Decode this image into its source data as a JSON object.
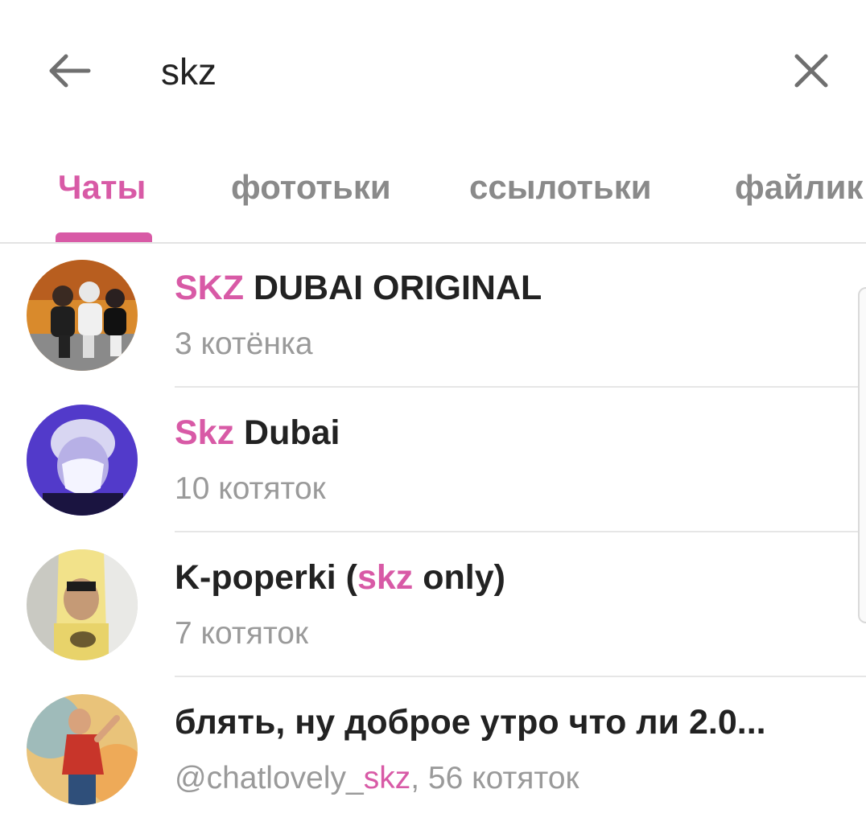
{
  "search": {
    "query": "skz",
    "back_icon": "arrow-left-icon",
    "clear_icon": "close-icon"
  },
  "tabs": [
    {
      "label": "Чаты",
      "active": true
    },
    {
      "label": "фототьки",
      "active": false
    },
    {
      "label": "ссылотьки",
      "active": false
    },
    {
      "label": "файлик",
      "active": false
    }
  ],
  "colors": {
    "accent": "#d85aa6",
    "text": "#222222",
    "muted": "#9a9a9a"
  },
  "results": [
    {
      "title_highlight": "SKZ",
      "title_rest": " DUBAI ORIGINAL",
      "subtitle": "3 котёнка"
    },
    {
      "title_highlight": "Skz",
      "title_rest": " Dubai",
      "subtitle": "10 котяток"
    },
    {
      "title_before": "K-poperki (",
      "title_highlight": "skz",
      "title_after": " only)",
      "subtitle": "7 котяток"
    },
    {
      "title": "блять, ну доброе утро что ли 2.0...",
      "sub_before": "@chatlovely_",
      "sub_highlight": "skz",
      "sub_after": ", 56 котяток"
    }
  ]
}
